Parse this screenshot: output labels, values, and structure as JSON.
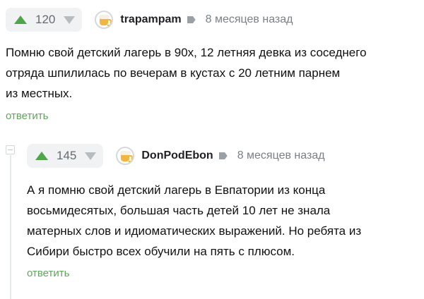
{
  "comments": [
    {
      "votes": "120",
      "username": "trapampam",
      "time": "8 месяцев назад",
      "text_lines": [
        "Помню свой детский лагерь в 90х, 12 летняя девка из соседнего",
        "отряда шпилилась по вечерам в кустах с 20 летним парнем",
        "из местных."
      ],
      "reply_label": "ответить"
    },
    {
      "votes": "145",
      "username": "DonPodEbon",
      "time": "8 месяцев назад",
      "text_lines": [
        "А я помню свой детский лагерь в Евпатории из конца",
        "восьмидесятых, большая часть детей 10 лет не знала",
        "матерных слов и идиоматических выражений. Но ребята из",
        "Сибири быстро всех обучили на пять с плюсом."
      ],
      "reply_label": "ответить"
    }
  ],
  "colors": {
    "upvote": "#4fa64a",
    "downvote": "#b7bcc1",
    "reply_link": "#5ea65b"
  },
  "icons": {
    "upvote": "triangle-up-icon",
    "downvote": "triangle-down-icon",
    "avatar": "beer-mug-avatar",
    "tag": "tag-icon",
    "collapse": "collapse-box-icon"
  }
}
